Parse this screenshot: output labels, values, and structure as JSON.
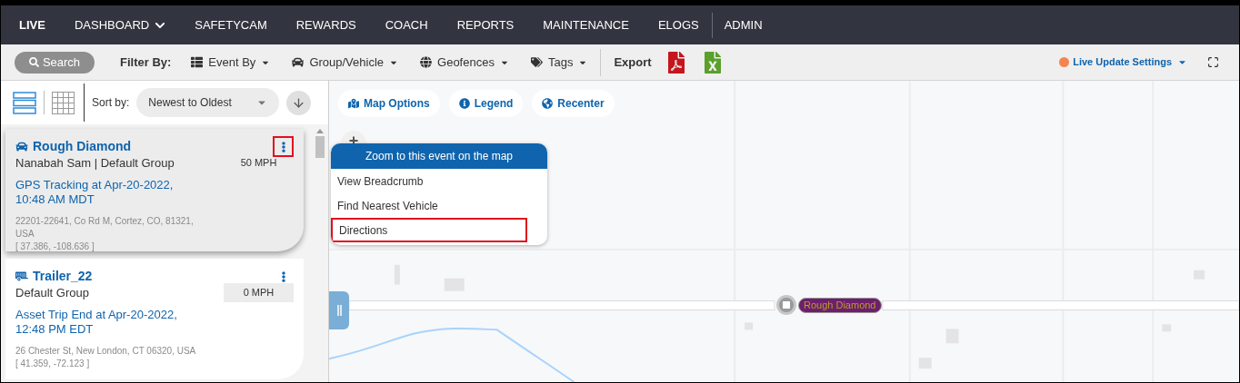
{
  "nav": {
    "items": [
      {
        "label": "LIVE",
        "selected": true,
        "dropdown": false,
        "separator_before": false
      },
      {
        "label": "DASHBOARD",
        "selected": false,
        "dropdown": true,
        "separator_before": false
      },
      {
        "label": "SAFETYCAM",
        "selected": false,
        "dropdown": false,
        "separator_before": false
      },
      {
        "label": "REWARDS",
        "selected": false,
        "dropdown": false,
        "separator_before": false
      },
      {
        "label": "COACH",
        "selected": false,
        "dropdown": false,
        "separator_before": false
      },
      {
        "label": "REPORTS",
        "selected": false,
        "dropdown": false,
        "separator_before": false
      },
      {
        "label": "MAINTENANCE",
        "selected": false,
        "dropdown": false,
        "separator_before": false
      },
      {
        "label": "ELOGS",
        "selected": false,
        "dropdown": false,
        "separator_before": false
      },
      {
        "label": "ADMIN",
        "selected": false,
        "dropdown": false,
        "separator_before": true
      }
    ]
  },
  "filter_bar": {
    "search": "Search",
    "filter_label": "Filter By:",
    "filters": [
      {
        "label": "Event By",
        "kind": "list"
      },
      {
        "label": "Group/Vehicle",
        "kind": "car"
      },
      {
        "label": "Geofences",
        "kind": "globe"
      },
      {
        "label": "Tags",
        "kind": "tags"
      }
    ],
    "export_label": "Export",
    "exports": [
      {
        "kind": "pdf"
      },
      {
        "kind": "excel"
      }
    ],
    "live_update": {
      "label": "Live Update Settings",
      "color": "#f5854f"
    }
  },
  "sidebar": {
    "views": [
      {
        "kind": "list",
        "selected": true
      },
      {
        "kind": "grid",
        "selected": false
      }
    ],
    "sort_label": "Sort by:",
    "sort_value": "Newest to Oldest",
    "cards": [
      {
        "kind": "car",
        "title": "Rough Diamond",
        "subtitle": "Nanabah Sam |  Default Group",
        "speed": "50 MPH",
        "event": "GPS Tracking at Apr-20-2022, 10:48 AM MDT",
        "address": "22201-22641, Co Rd M, Cortez, CO, 81321, USA",
        "coords": "[ 37.386, -108.636 ]",
        "selected": true,
        "menu_highlighted": true
      },
      {
        "kind": "trailer",
        "title": "Trailer_22",
        "subtitle": "Default Group",
        "speed": "0 MPH",
        "event": "Asset Trip End at Apr-20-2022, 12:48 PM EDT",
        "address": "26 Chester St, New London, CT 06320, USA",
        "coords": "[ 41.359, -72.123 ]",
        "selected": false,
        "menu_highlighted": false
      }
    ]
  },
  "map": {
    "buttons": [
      {
        "label": "Map Options",
        "kind": "map"
      },
      {
        "label": "Legend",
        "kind": "info"
      },
      {
        "label": "Recenter",
        "kind": "globe"
      }
    ],
    "zoom_in": "+",
    "context_menu": {
      "header": "Zoom to this event on the map",
      "items": [
        {
          "label": "View Breadcrumb",
          "highlighted": false
        },
        {
          "label": "Find Nearest Vehicle",
          "highlighted": false
        },
        {
          "label": "Directions",
          "highlighted": true
        }
      ]
    },
    "marker": {
      "label": "Rough Diamond"
    }
  }
}
